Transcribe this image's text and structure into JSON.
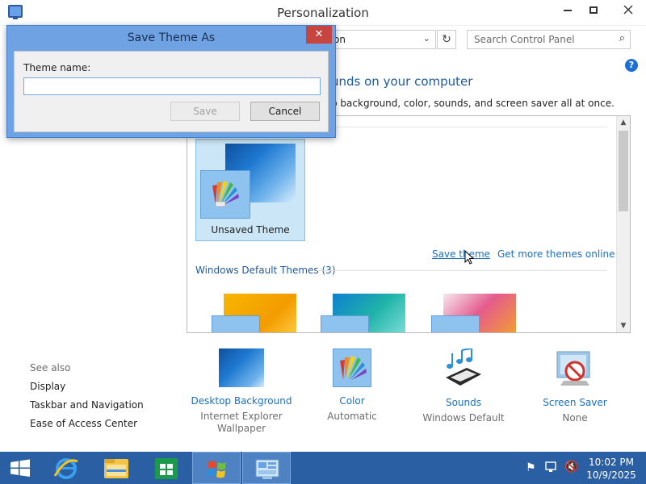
{
  "window": {
    "title": "Personalization"
  },
  "address_bar": {
    "text": "on"
  },
  "search": {
    "placeholder": "Search Control Panel"
  },
  "main": {
    "heading": "unds on your computer",
    "subheading": "p background, color, sounds, and screen saver all at once."
  },
  "themes": {
    "unsaved_label": "Unsaved Theme",
    "save_theme_link": "Save theme",
    "more_themes_link": "Get more themes online",
    "group_title": "Windows Default Themes (3)"
  },
  "see_also": {
    "title": "See also",
    "links": [
      "Display",
      "Taskbar and Navigation",
      "Ease of Access Center"
    ]
  },
  "bottom_items": [
    {
      "title": "Desktop Background",
      "sub": "Internet Explorer Wallpaper"
    },
    {
      "title": "Color",
      "sub": "Automatic"
    },
    {
      "title": "Sounds",
      "sub": "Windows Default"
    },
    {
      "title": "Screen Saver",
      "sub": "None"
    }
  ],
  "dialog": {
    "title": "Save Theme As",
    "label": "Theme name:",
    "input_value": "",
    "save_label": "Save",
    "cancel_label": "Cancel",
    "close_glyph": "✕"
  },
  "taskbar": {
    "time": "10:02 PM",
    "date": "10/9/2025"
  },
  "colors": {
    "accent": "#1e6fbf",
    "taskbar": "#2a5fa3",
    "dialog_frame": "#6ea2e3",
    "close_red": "#c7443f"
  },
  "icons": [
    "app-monitor-icon",
    "search-icon",
    "help-icon",
    "refresh-icon",
    "palette-icon",
    "sounds-icon",
    "screensaver-icon",
    "windows-logo-icon",
    "ie-icon",
    "explorer-icon",
    "store-icon",
    "control-panel-icon",
    "flag-icon",
    "network-icon",
    "volume-muted-icon"
  ]
}
